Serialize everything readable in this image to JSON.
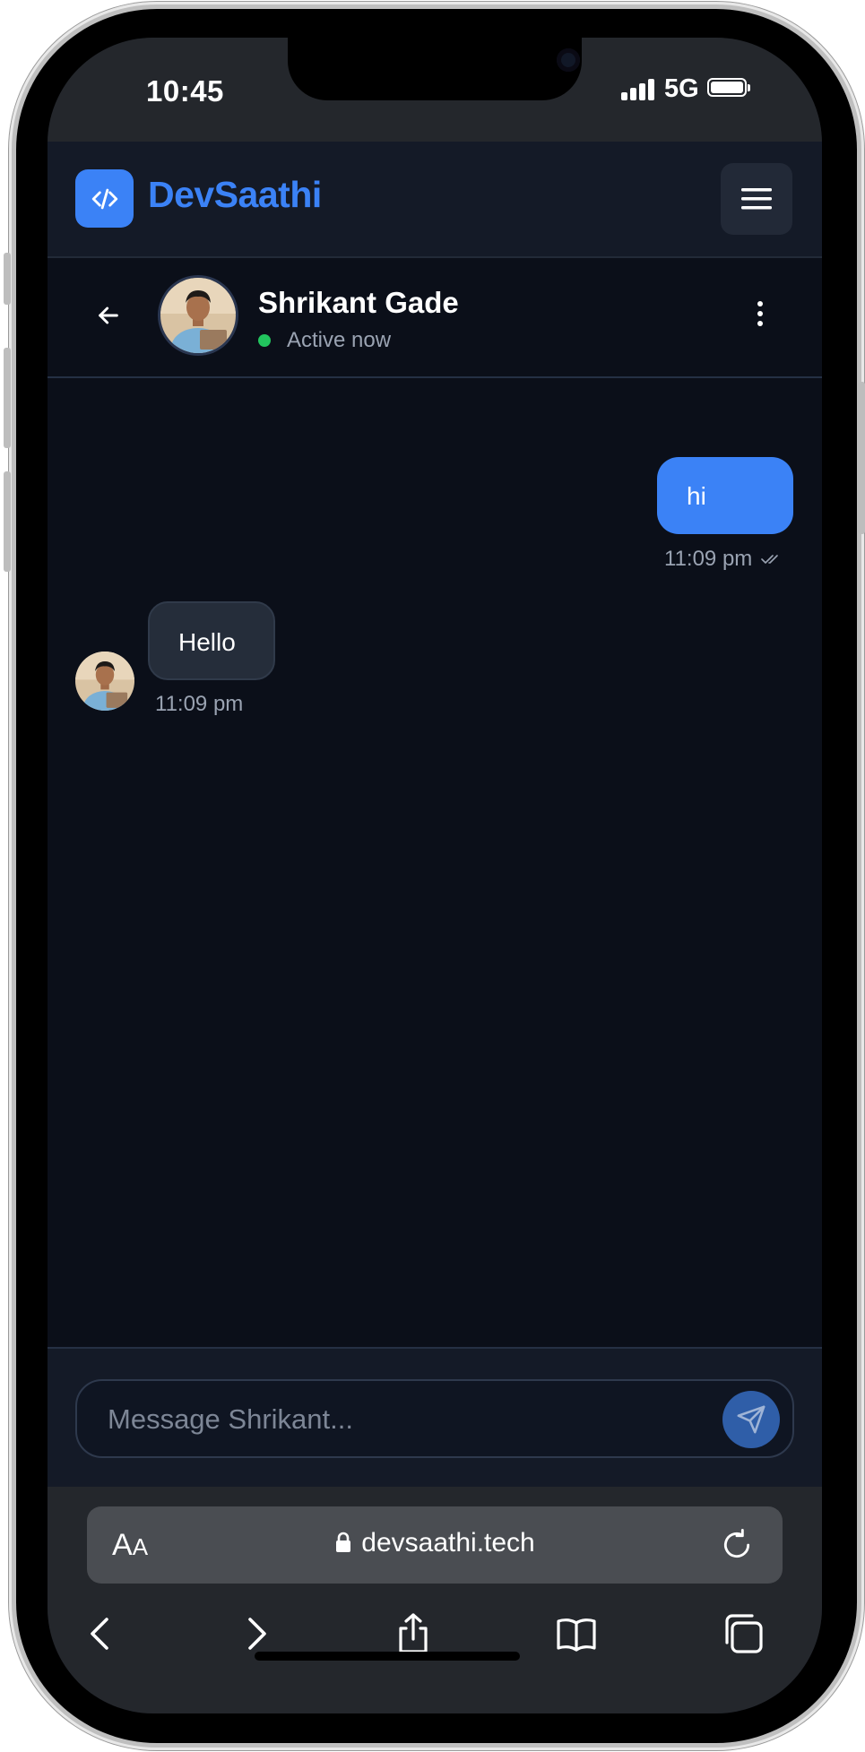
{
  "status_bar": {
    "time": "10:45",
    "network": "5G",
    "icons": [
      "signal-icon",
      "battery-icon"
    ]
  },
  "app_header": {
    "brand": "DevSaathi",
    "logo_icon": "code-icon",
    "menu_icon": "hamburger-menu-icon",
    "accent_color": "#3b82f6"
  },
  "chat_header": {
    "contact_name": "Shrikant Gade",
    "status": "Active now",
    "status_color": "#22c55e"
  },
  "messages": [
    {
      "direction": "outgoing",
      "text": "hi",
      "time": "11:09 pm",
      "read_icon": "double-check-icon"
    },
    {
      "direction": "incoming",
      "text": "Hello",
      "time": "11:09 pm"
    }
  ],
  "composer": {
    "placeholder": "Message Shrikant...",
    "value": ""
  },
  "browser": {
    "text_size_label": "AA",
    "url": "devsaathi.tech",
    "nav_icons": [
      "back-icon",
      "forward-icon",
      "share-icon",
      "bookmarks-icon",
      "tabs-icon"
    ]
  }
}
